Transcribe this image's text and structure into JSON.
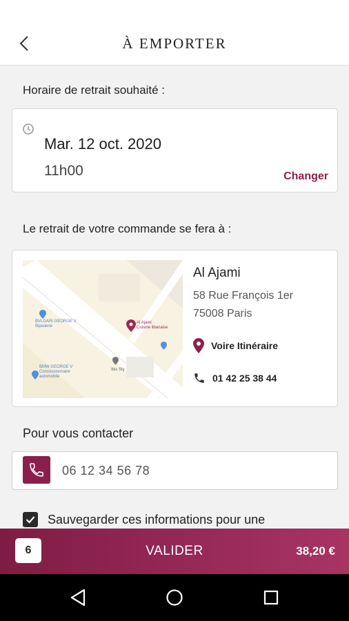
{
  "header": {
    "title": "À EMPORTER",
    "back_icon": "chevron-left-icon"
  },
  "pickup_time": {
    "label": "Horaire de retrait souhaité :",
    "date": "Mar. 12 oct. 2020",
    "hour": "11h00",
    "change_label": "Changer",
    "icon": "clock-icon"
  },
  "pickup_location": {
    "label": "Le retrait de votre commande se fera à :",
    "restaurant_name": "Al Ajami",
    "address_line1": "58 Rue François 1er",
    "address_line2": "75008 Paris",
    "directions_label": "Voire Itinéraire",
    "phone": "01 42 25 38 44",
    "map": {
      "poi_1_name": "BVLGARI GEORGE V",
      "poi_1_sub": "Bijouterie",
      "poi_2_name": "BMW GEORGE V",
      "poi_2_sub": "Concessionnaire automobile",
      "poi_3_name": "Al Ajami",
      "poi_3_sub": "Cuisine libanaise",
      "poi_4_name": "Ibis Sty"
    }
  },
  "contact": {
    "label": "Pour vous contacter",
    "phone_value": "06 12 34 56 78",
    "phone_icon": "phone-icon"
  },
  "save_info": {
    "label": "Sauvegarder ces informations pour une",
    "checked": true
  },
  "bottom_bar": {
    "quantity": "6",
    "validate_label": "VALIDER",
    "total": "38,20 €"
  },
  "colors": {
    "accent": "#8e1f4d",
    "bar_start": "#7f1c44",
    "bar_end": "#a83464"
  },
  "android_nav": {
    "back": "triangle-back-icon",
    "home": "circle-home-icon",
    "recents": "square-recents-icon"
  }
}
